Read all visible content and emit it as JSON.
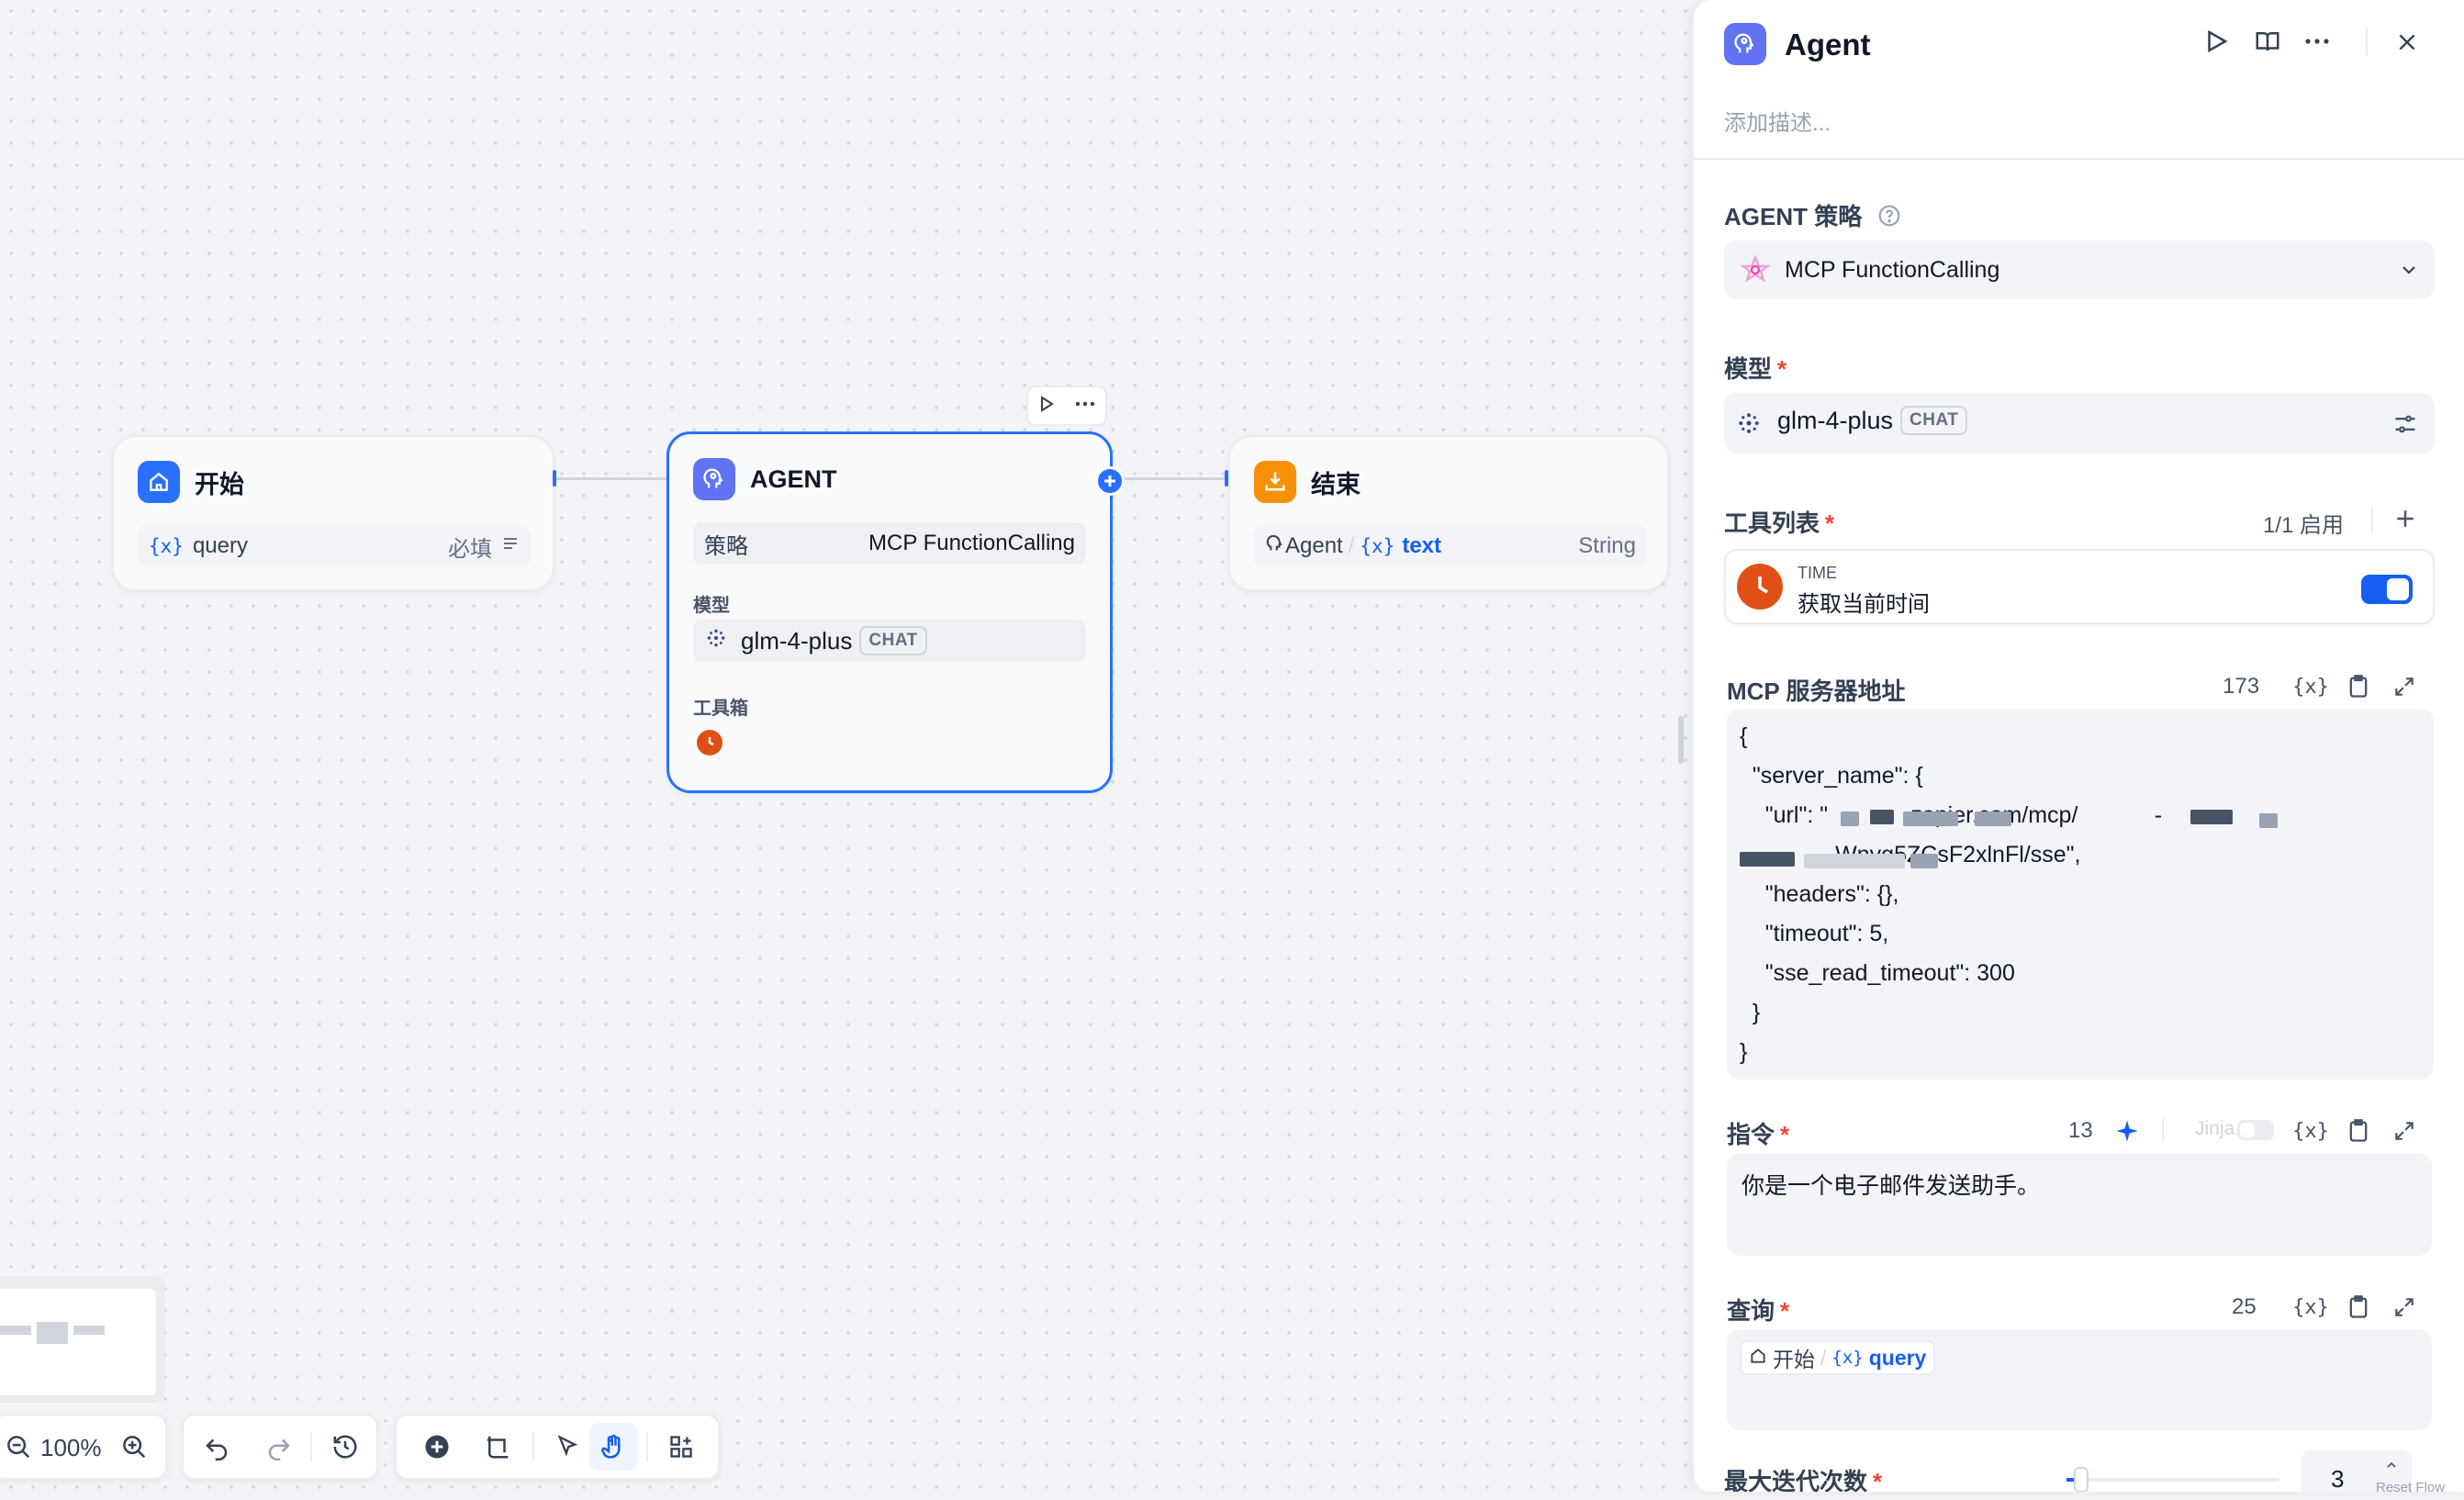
{
  "canvas": {
    "start_node": {
      "title": "开始",
      "var_name": "query",
      "required_label": "必填"
    },
    "agent_node": {
      "title": "AGENT",
      "strategy_label": "策略",
      "strategy_value": "MCP FunctionCalling",
      "model_label": "模型",
      "model_name": "glm-4-plus",
      "model_badge": "CHAT",
      "toolbox_label": "工具箱"
    },
    "end_node": {
      "title": "结束",
      "source_node": "Agent",
      "separator": "/",
      "var_name": "text",
      "var_type": "String"
    },
    "var_glyph": "{x}"
  },
  "toolbar": {
    "zoom": "100%"
  },
  "panel": {
    "title": "Agent",
    "description_placeholder": "添加描述...",
    "strategy": {
      "label": "AGENT 策略",
      "value": "MCP FunctionCalling"
    },
    "model": {
      "label": "模型",
      "required": "*",
      "name": "glm-4-plus",
      "badge": "CHAT"
    },
    "tools": {
      "label": "工具列表",
      "required": "*",
      "enabled_count": "1/1 启用",
      "items": [
        {
          "provider": "TIME",
          "name": "获取当前时间",
          "enabled": true
        }
      ]
    },
    "mcp": {
      "label": "MCP 服务器地址",
      "count": "173",
      "lines": [
        "{",
        "  \"server_name\": {",
        "    \"url\": \"            .zapier.com/mcp/            -",
        "               Wnyq5ZCsF2xlnFl/sse\",",
        "    \"headers\": {},",
        "    \"timeout\": 5,",
        "    \"sse_read_timeout\": 300",
        "  }",
        "}"
      ]
    },
    "instruction": {
      "label": "指令",
      "required": "*",
      "count": "13",
      "jinja_label": "Jinja",
      "text": "你是一个电子邮件发送助手。"
    },
    "query": {
      "label": "查询",
      "required": "*",
      "count": "25",
      "source_node": "开始",
      "separator": "/",
      "var_name": "query"
    },
    "max_iterations": {
      "label": "最大迭代次数",
      "required": "*",
      "value": "3",
      "slider_fraction": 0.02,
      "reset_label": "Reset Flow"
    }
  },
  "colors": {
    "accent": "#155eef",
    "agent_icon": "#6172f3",
    "start_icon": "#2970ff",
    "end_icon": "#f79009",
    "time_tool": "#e04f16",
    "required": "#f04438"
  }
}
